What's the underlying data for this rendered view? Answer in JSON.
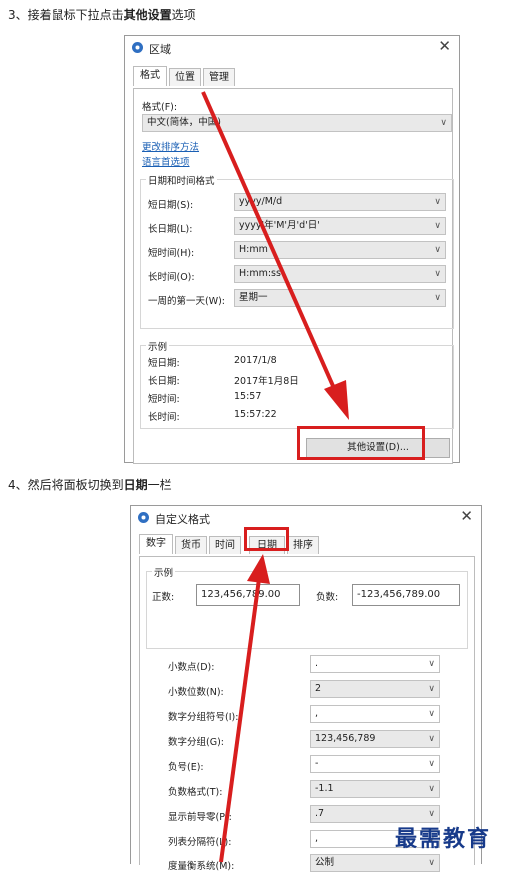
{
  "step3": {
    "prefix": "3、接着鼠标下拉点击",
    "bold": "其他设置",
    "suffix": "选项"
  },
  "step4": {
    "prefix": "4、然后将面板切换到",
    "bold": "日期",
    "suffix": "一栏"
  },
  "region_dialog": {
    "title": "区域",
    "tabs": [
      "格式",
      "位置",
      "管理"
    ],
    "format_label": "格式(F):",
    "format_value": "中文(简体，中国)",
    "link_sort": "更改排序方法",
    "link_lang": "语言首选项",
    "group_title": "日期和时间格式",
    "rows": [
      {
        "label": "短日期(S):",
        "value": "yyyy/M/d"
      },
      {
        "label": "长日期(L):",
        "value": "yyyy'年'M'月'd'日'"
      },
      {
        "label": "短时间(H):",
        "value": "H:mm"
      },
      {
        "label": "长时间(O):",
        "value": "H:mm:ss"
      },
      {
        "label": "一周的第一天(W):",
        "value": "星期一"
      }
    ],
    "example_title": "示例",
    "examples": [
      {
        "label": "短日期:",
        "value": "2017/1/8"
      },
      {
        "label": "长日期:",
        "value": "2017年1月8日"
      },
      {
        "label": "短时间:",
        "value": "15:57"
      },
      {
        "label": "长时间:",
        "value": "15:57:22"
      }
    ],
    "other_button": "其他设置(D)..."
  },
  "custom_dialog": {
    "title": "自定义格式",
    "tabs": [
      "数字",
      "货币",
      "时间",
      "日期",
      "排序"
    ],
    "example_title": "示例",
    "positive_label": "正数:",
    "positive_value": "123,456,789.00",
    "negative_label": "负数:",
    "negative_value": "-123,456,789.00",
    "rows": [
      {
        "label": "小数点(D):",
        "value": "."
      },
      {
        "label": "小数位数(N):",
        "value": "2"
      },
      {
        "label": "数字分组符号(I):",
        "value": ","
      },
      {
        "label": "数字分组(G):",
        "value": "123,456,789"
      },
      {
        "label": "负号(E):",
        "value": "-"
      },
      {
        "label": "负数格式(T):",
        "value": "-1.1"
      },
      {
        "label": "显示前导零(P):",
        "value": ".7"
      },
      {
        "label": "列表分隔符(L):",
        "value": ","
      },
      {
        "label": "度量衡系统(M):",
        "value": "公制"
      }
    ]
  },
  "watermark": "最需教育",
  "colors": {
    "arrow": "#d81e1e",
    "link": "#1a5fb4",
    "watermark": "#173a8a"
  }
}
